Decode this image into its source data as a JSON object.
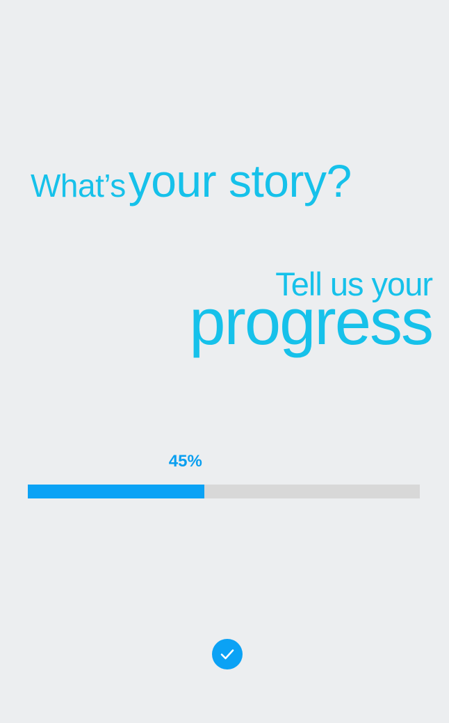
{
  "headline": {
    "prefix": "What’s",
    "emphasis": "your story?"
  },
  "tagline": {
    "line1": "Tell us your",
    "line2": "progress"
  },
  "progress": {
    "label": "45%",
    "value": 0.45
  },
  "confirm_icon": "checkmark-icon",
  "colors": {
    "background": "#eceef0",
    "headline": "#16c1ea",
    "accent": "#0ba2f5",
    "track": "#d8d8d8"
  }
}
